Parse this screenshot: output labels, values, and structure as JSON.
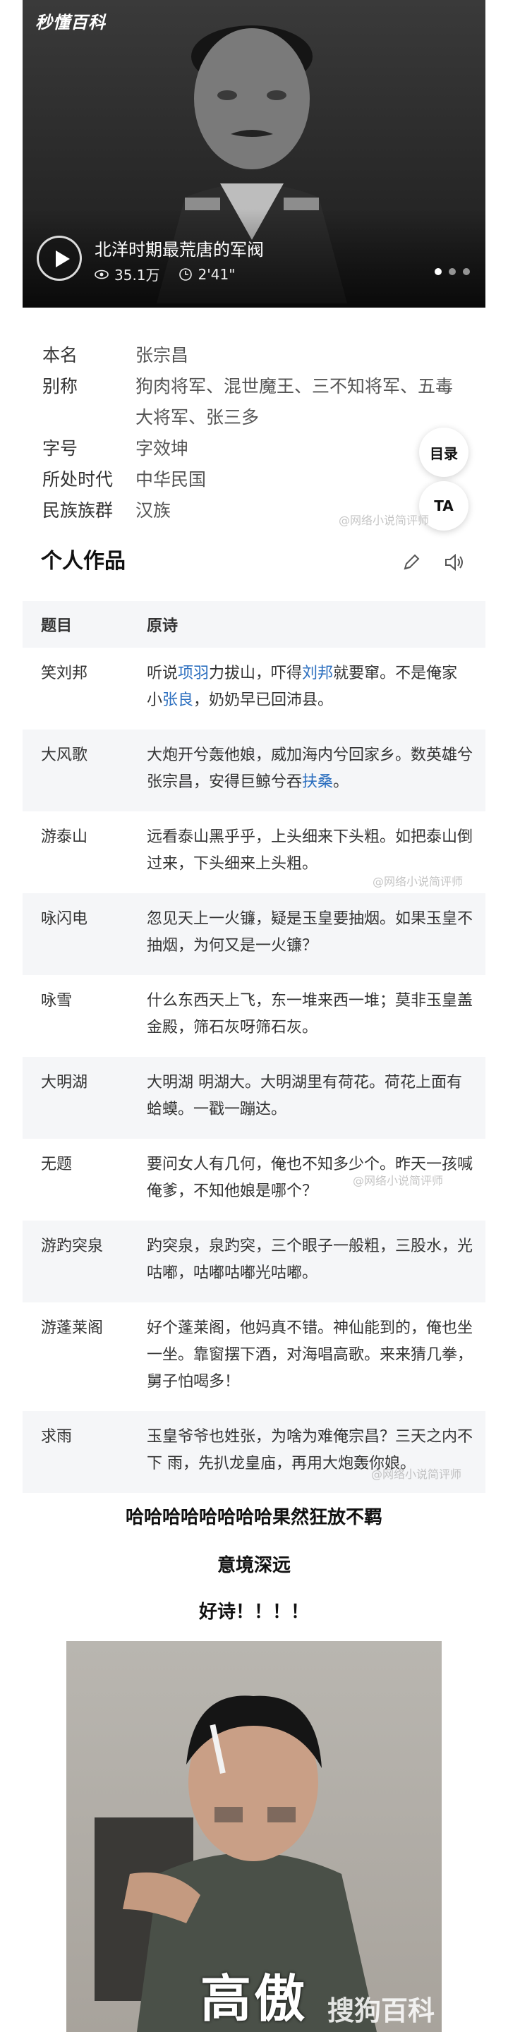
{
  "video": {
    "brand": "秒懂百科",
    "title": "北洋时期最荒唐的军阀",
    "views": "35.1万",
    "duration": "2'41\""
  },
  "info": {
    "rows": [
      {
        "label": "本名",
        "value": "张宗昌"
      },
      {
        "label": "别称",
        "value": "狗肉将军、混世魔王、三不知将军、五毒大将军、张三多"
      },
      {
        "label": "字号",
        "value": "字效坤"
      },
      {
        "label": "所处时代",
        "value": "中华民国"
      },
      {
        "label": "民族族群",
        "value": "汉族"
      }
    ],
    "toc_label": "目录",
    "ta_label": "TA"
  },
  "watermark": "@网络小说简评师",
  "works": {
    "title": "个人作品",
    "col_title": "题目",
    "col_poem": "原诗",
    "rows": [
      {
        "title": "笑刘邦",
        "poem_parts": [
          "听说",
          "项羽",
          "力拔山，吓得",
          "刘邦",
          "就要窜。不是俺家小",
          "张良",
          "，奶奶早已回沛县。"
        ]
      },
      {
        "title": "大风歌",
        "poem_parts": [
          "大炮开兮轰他娘，威加海内兮回家乡。数英雄兮张宗昌，安得巨鲸兮吞",
          "扶桑",
          "。"
        ]
      },
      {
        "title": "游泰山",
        "poem": "远看泰山黑乎乎，上头细来下头粗。如把泰山倒过来，下头细来上头粗。"
      },
      {
        "title": "咏闪电",
        "poem": "忽见天上一火镰，疑是玉皇要抽烟。如果玉皇不抽烟，为何又是一火镰？"
      },
      {
        "title": "咏雪",
        "poem": "什么东西天上飞，东一堆来西一堆；莫非玉皇盖金殿，筛石灰呀筛石灰。"
      },
      {
        "title": "大明湖",
        "poem": "大明湖 明湖大。大明湖里有荷花。荷花上面有蛤蟆。一戳一蹦达。"
      },
      {
        "title": "无题",
        "poem": "要问女人有几何，俺也不知多少个。昨天一孩喊俺爹，不知他娘是哪个？"
      },
      {
        "title": "游趵突泉",
        "poem": "趵突泉，泉趵突，三个眼子一般粗，三股水，光咕嘟，咕嘟咕嘟光咕嘟。"
      },
      {
        "title": "游蓬莱阁",
        "poem": "好个蓬莱阁，他妈真不错。神仙能到的，俺也坐一坐。靠窗摆下酒，对海唱高歌。来来猜几拳，舅子怕喝多！"
      },
      {
        "title": "求雨",
        "poem": "玉皇爷爷也姓张，为啥为难俺宗昌？三天之内不下 雨，先扒龙皇庙，再用大炮轰你娘。"
      }
    ]
  },
  "captions": [
    "哈哈哈哈哈哈哈哈果然狂放不羁",
    "意境深远",
    "好诗！！！！"
  ],
  "meme": {
    "text": "高傲",
    "watermark": "搜狗百科"
  },
  "colors": {
    "link": "#2c6fbf",
    "table_alt": "#f5f6f8"
  }
}
